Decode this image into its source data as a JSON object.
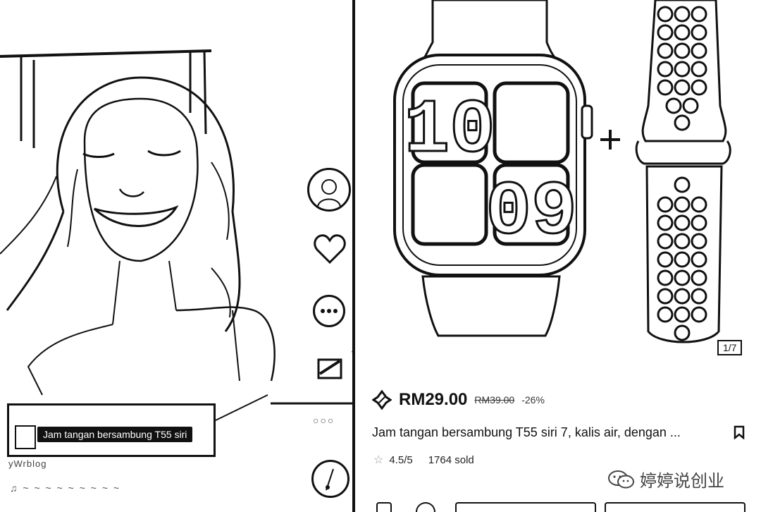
{
  "video": {
    "product_tag_label": "Jam tangan bersambung T55 siri",
    "username": "yWrblog",
    "music": "♫ ~ ~ ~ ~ ~ ~ ~ ~ ~",
    "more_dots": "○○○"
  },
  "product": {
    "image_counter": "1/7",
    "price": "RM29.00",
    "original_price": "RM39.00",
    "discount": "-26%",
    "title": "Jam tangan bersambung T55 siri 7, kalis air, dengan ...",
    "rating": "4.5/5",
    "sold": "1764 sold",
    "watch_time": [
      "10",
      "09"
    ]
  },
  "watermark": {
    "text": "婷婷说创业"
  },
  "colors": {
    "ink": "#111111",
    "paper": "#ffffff"
  },
  "icons": {
    "price": "flash-sale-icon",
    "bookmark": "bookmark-icon",
    "rating": "star-icon",
    "watermark": "wechat-icon"
  }
}
